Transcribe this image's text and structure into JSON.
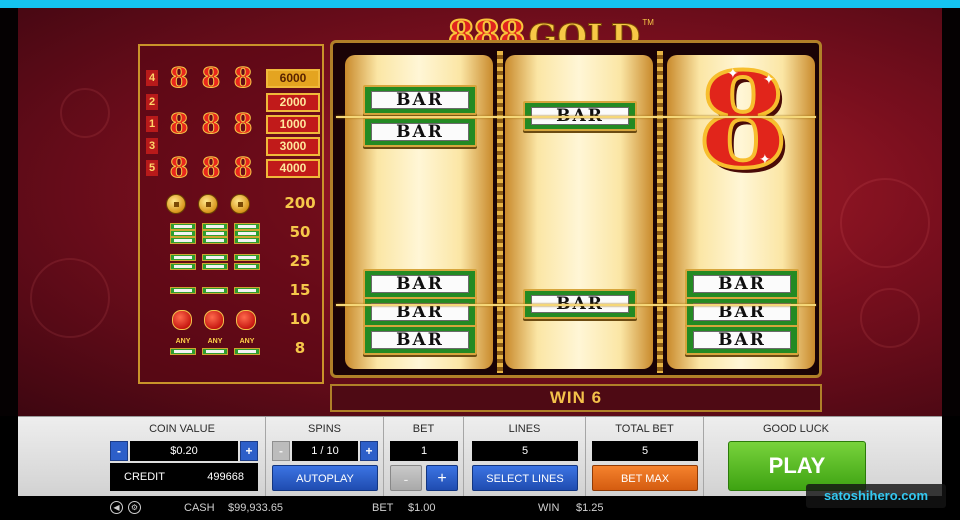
{
  "logo": {
    "digits": "888",
    "word": "GOLD",
    "tm": "TM"
  },
  "paytable": {
    "lines": [
      {
        "number": "4",
        "prize": "6000",
        "highlight": true
      },
      {
        "number": "2",
        "prize": "2000",
        "highlight": false
      },
      {
        "number": "1",
        "prize": "1000",
        "highlight": false
      },
      {
        "number": "3",
        "prize": "3000",
        "highlight": false
      },
      {
        "number": "5",
        "prize": "4000",
        "highlight": false
      }
    ],
    "eight_symbol": "8",
    "symbol_prizes": [
      {
        "symbol": "coin-icon",
        "prize": "200"
      },
      {
        "symbol": "triple-bar",
        "prize": "50"
      },
      {
        "symbol": "double-bar",
        "prize": "25"
      },
      {
        "symbol": "single-bar",
        "prize": "15"
      },
      {
        "symbol": "lantern-icon",
        "prize": "10"
      },
      {
        "symbol": "any-bar",
        "prize": "8"
      }
    ],
    "any_label": "ANY",
    "bar_label": "BAR"
  },
  "reels": {
    "bar_label": "BAR",
    "big_symbol": "8"
  },
  "win_text": "WIN 6",
  "controls": {
    "coin_value": {
      "title": "COIN VALUE",
      "value": "$0.20",
      "minus": "-",
      "plus": "+"
    },
    "credit": {
      "label": "CREDIT",
      "value": "499668"
    },
    "spins": {
      "title": "SPINS",
      "value": "1 / 10",
      "minus": "-",
      "plus": "+",
      "autoplay_label": "AUTOPLAY"
    },
    "bet": {
      "title": "BET",
      "value": "1",
      "minus": "-",
      "plus": "+"
    },
    "lines": {
      "title": "LINES",
      "value": "5",
      "select_label": "SELECT LINES"
    },
    "total_bet": {
      "title": "TOTAL BET",
      "value": "5",
      "bet_max_label": "BET MAX"
    },
    "good_luck": {
      "title": "GOOD LUCK",
      "play_label": "PLAY"
    }
  },
  "status_bar": {
    "cash_label": "CASH",
    "cash_value": "$99,933.65",
    "bet_label": "BET",
    "bet_value": "$1.00",
    "win_label": "WIN",
    "win_value": "$1.25"
  },
  "watermark": "satoshihero.com",
  "colors": {
    "accent_blue": "#2d5fc9",
    "play_green": "#56bb22",
    "bet_max_orange": "#e46c1c",
    "gold": "#f3c14a",
    "felt_red": "#8d1322"
  }
}
